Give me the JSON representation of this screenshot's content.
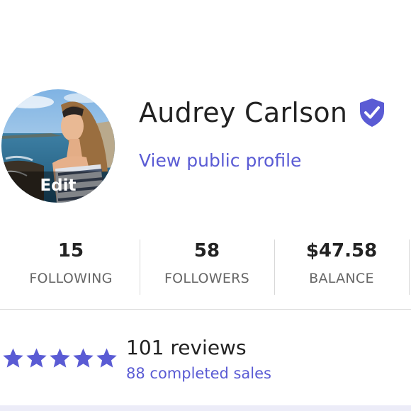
{
  "profile": {
    "name": "Audrey Carlson",
    "avatar_edit_label": "Edit",
    "verified_icon": "verified-shield-check-icon",
    "public_profile_link": "View public profile"
  },
  "stats": [
    {
      "value": "15",
      "label": "FOLLOWING"
    },
    {
      "value": "58",
      "label": "FOLLOWERS"
    },
    {
      "value": "$47.58",
      "label": "BALANCE"
    }
  ],
  "reviews": {
    "rating": 5,
    "rating_max": 5,
    "count_label": "101 reviews",
    "completed_sales_label": "88 completed sales"
  },
  "colors": {
    "accent": "#5a5bd4",
    "text": "#222222",
    "muted": "#666666",
    "divider": "#d8d8d8"
  }
}
